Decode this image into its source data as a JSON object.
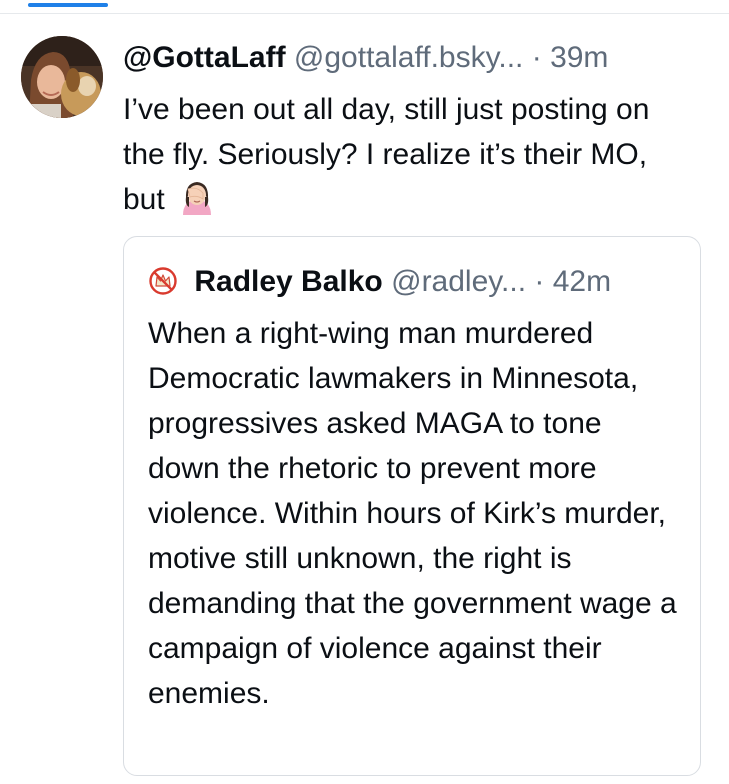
{
  "post": {
    "author": {
      "display_name": "@GottaLaff",
      "handle": "@gottalaff.bsky...",
      "avatar_icon": "profile-photo-woman-with-dog"
    },
    "separator": "·",
    "time": "39m",
    "text": "I’ve been out all day, still just posting on the fly. Seriously? I realize it’s their MO, but",
    "emoji": "woman-facepalming-emoji"
  },
  "quote": {
    "author": {
      "display_name": "Radley Balko",
      "handle": "@radley...",
      "avatar_icon": "no-crown-icon"
    },
    "separator": "·",
    "time": "42m",
    "text": "When a right-wing man murdered Democratic lawmakers in Minnesota, progressives asked MAGA to tone down the rhetoric to prevent more violence. Within hours of Kirk’s murder, motive still unknown, the right is demanding that the government wage a campaign of violence against their enemies."
  },
  "colors": {
    "text": "#0b0f14",
    "muted": "#5f6b7a",
    "border": "#d9dde2",
    "accent": "#1f80e8"
  }
}
